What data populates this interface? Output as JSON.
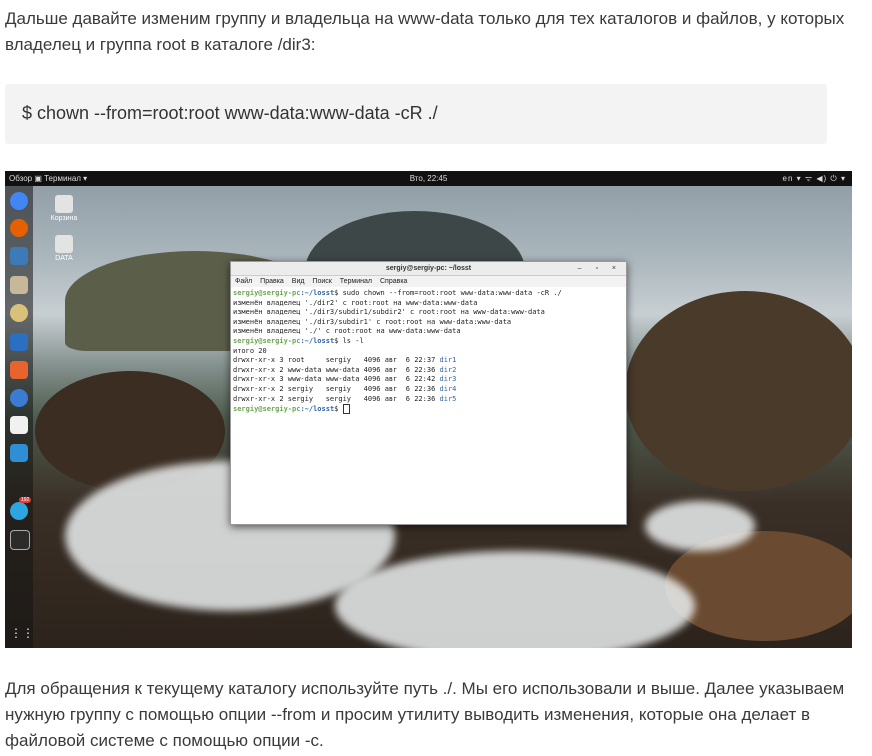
{
  "article": {
    "para_top": "Дальше давайте изменим группу и владельца на www-data только для тех каталогов и файлов, у которых владелец и группа root в каталоге /dir3:",
    "code": "$ chown --from=root:root www-data:www-data -cR ./",
    "para_bottom": "Для обращения к текущему каталогу используйте путь ./. Мы его использовали и выше. Далее указываем нужную группу с помощью опции --from и просим утилиту выводить изменения, которые она делает в файловой системе с помощью опции -c."
  },
  "screenshot": {
    "topbar": {
      "left": "Обзор  ▣ Терминал ▾",
      "clock": "Вто, 22:45",
      "right": "en ▾   ᯤ ◀) ⏻ ▾"
    },
    "desktop_icons": [
      "Корзина",
      "DATA"
    ],
    "dock_badge": "192",
    "terminal": {
      "title": "sergiy@sergiy-pc: ~/losst",
      "window_buttons": "– ▫ ×",
      "menu": [
        "Файл",
        "Правка",
        "Вид",
        "Поиск",
        "Терминал",
        "Справка"
      ],
      "prompt_user": "sergiy@sergiy-pc",
      "prompt_path": ":~/losst",
      "cmd1": "$ sudo chown --from=root:root www-data:www-data -cR ./",
      "out": [
        "изменён владелец './dir2' с root:root на www-data:www-data",
        "изменён владелец './dir3/subdir1/subdir2' с root:root на www-data:www-data",
        "изменён владелец './dir3/subdir1' с root:root на www-data:www-data",
        "изменён владелец './' с root:root на www-data:www-data"
      ],
      "cmd2": "$ ls -l",
      "total": "итого 20",
      "rows": [
        {
          "perm": "drwxr-xr-x 3 root     sergiy   4096 авг  6 22:37 ",
          "name": "dir1"
        },
        {
          "perm": "drwxr-xr-x 2 www-data www-data 4096 авг  6 22:36 ",
          "name": "dir2"
        },
        {
          "perm": "drwxr-xr-x 3 www-data www-data 4096 авг  6 22:42 ",
          "name": "dir3"
        },
        {
          "perm": "drwxr-xr-x 2 sergiy   sergiy   4096 авг  6 22:36 ",
          "name": "dir4"
        },
        {
          "perm": "drwxr-xr-x 2 sergiy   sergiy   4096 авг  6 22:36 ",
          "name": "dir5"
        }
      ],
      "cmd3": "$ "
    }
  }
}
